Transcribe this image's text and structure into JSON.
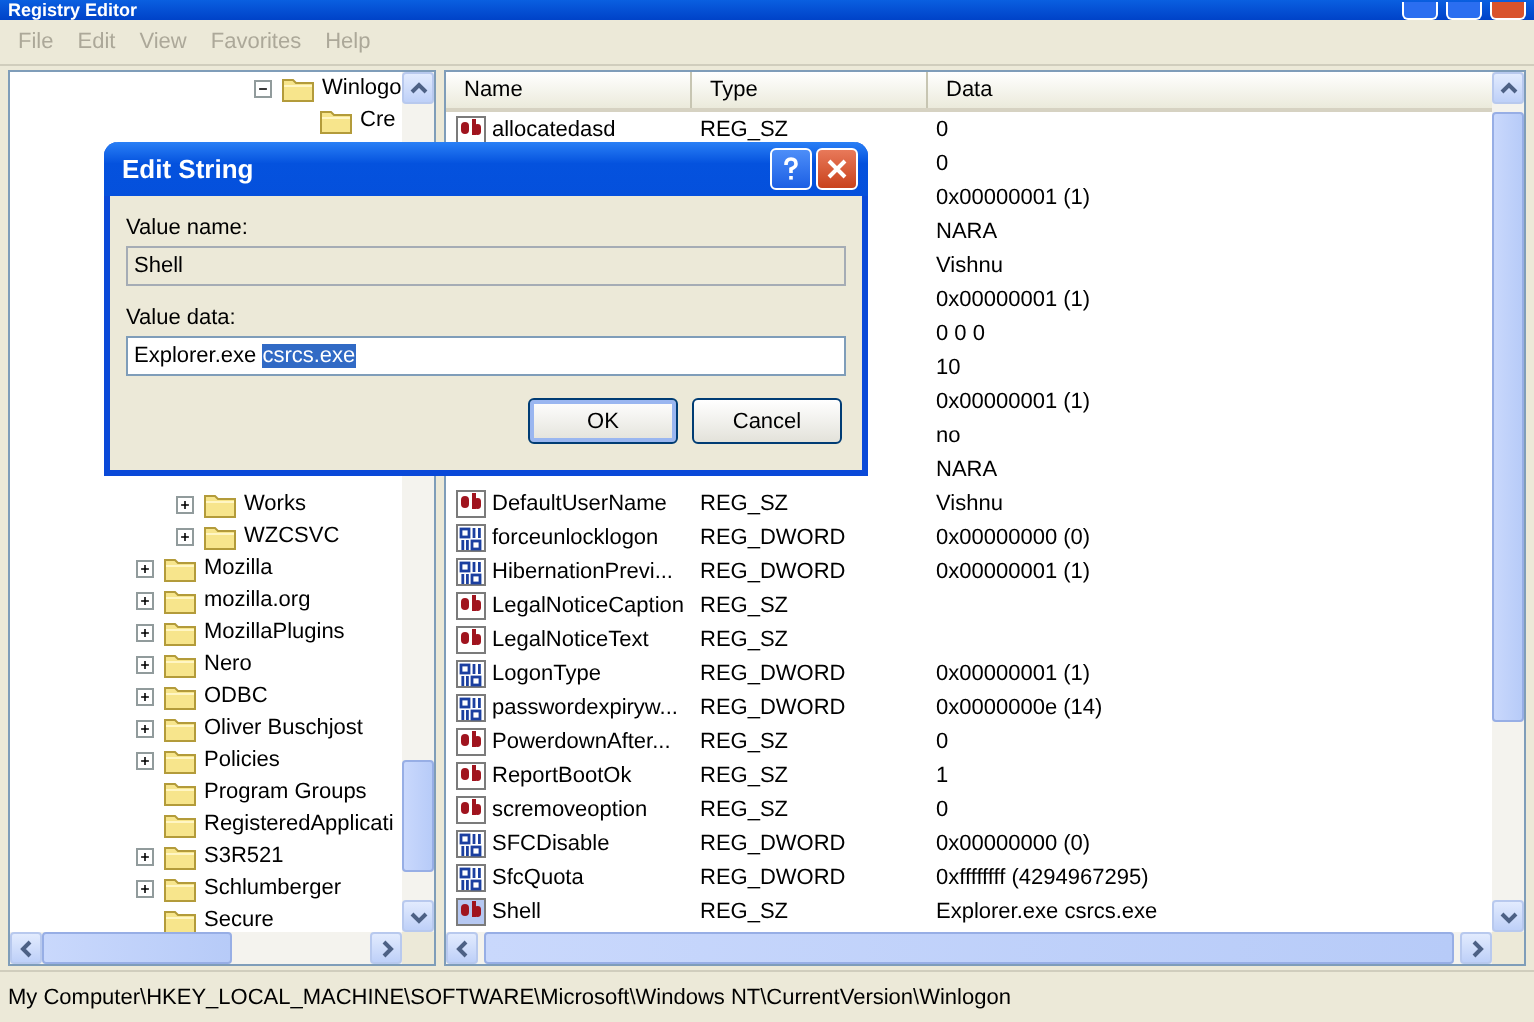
{
  "window": {
    "title": "Registry Editor"
  },
  "menu": [
    {
      "label": "File",
      "disabled": true
    },
    {
      "label": "Edit",
      "disabled": true
    },
    {
      "label": "View",
      "disabled": true
    },
    {
      "label": "Favorites",
      "disabled": true
    },
    {
      "label": "Help",
      "disabled": true
    }
  ],
  "tree": {
    "items": [
      {
        "children": [
          {
            "children": [
              {
                "children": [
                  {
                    "label": "Winlogo",
                    "expanded": true,
                    "children": [
                      {
                        "label": "Cre"
                      }
                    ]
                  }
                ]
              }
            ]
          },
          {
            "label": "Works",
            "expanded": false
          },
          {
            "label": "WZCSVC",
            "expanded": false
          }
        ]
      },
      {
        "label": "Mozilla",
        "expanded": false
      },
      {
        "label": "mozilla.org",
        "expanded": false
      },
      {
        "label": "MozillaPlugins",
        "expanded": false
      },
      {
        "label": "Nero",
        "expanded": false
      },
      {
        "label": "ODBC",
        "expanded": false
      },
      {
        "label": "Oliver Buschjost",
        "expanded": false
      },
      {
        "label": "Policies",
        "expanded": false
      },
      {
        "label": "Program Groups"
      },
      {
        "label": "RegisteredApplicati"
      },
      {
        "label": "S3R521",
        "expanded": false
      },
      {
        "label": "Schlumberger",
        "expanded": false
      },
      {
        "label": "Secure"
      }
    ]
  },
  "list": {
    "columns": [
      "Name",
      "Type",
      "Data"
    ],
    "rows": [
      {
        "kind": "string",
        "name": "allocatedasd",
        "type": "REG_SZ",
        "data": "0",
        "selected": false
      },
      {
        "kind": "covered",
        "data": "0"
      },
      {
        "kind": "covered",
        "data": "0x00000001 (1)"
      },
      {
        "kind": "covered",
        "data": "NARA"
      },
      {
        "kind": "covered",
        "data": "Vishnu"
      },
      {
        "kind": "covered",
        "data": "0x00000001 (1)"
      },
      {
        "kind": "covered",
        "data": "0 0 0"
      },
      {
        "kind": "covered",
        "data": "10"
      },
      {
        "kind": "covered",
        "data": "0x00000001 (1)"
      },
      {
        "kind": "covered",
        "data": "no"
      },
      {
        "kind": "covered",
        "data": "NARA"
      },
      {
        "kind": "string",
        "name": "DefaultUserName",
        "type": "REG_SZ",
        "data": "Vishnu",
        "selected": false
      },
      {
        "kind": "binary",
        "name": "forceunlocklogon",
        "type": "REG_DWORD",
        "data": "0x00000000 (0)",
        "selected": false
      },
      {
        "kind": "binary",
        "name": "HibernationPrevi...",
        "type": "REG_DWORD",
        "data": "0x00000001 (1)",
        "selected": false
      },
      {
        "kind": "string",
        "name": "LegalNoticeCaption",
        "type": "REG_SZ",
        "selected": false
      },
      {
        "kind": "string",
        "name": "LegalNoticeText",
        "type": "REG_SZ",
        "selected": false
      },
      {
        "kind": "binary",
        "name": "LogonType",
        "type": "REG_DWORD",
        "data": "0x00000001 (1)",
        "selected": false
      },
      {
        "kind": "binary",
        "name": "passwordexpiryw...",
        "type": "REG_DWORD",
        "data": "0x0000000e (14)",
        "selected": false
      },
      {
        "kind": "string",
        "name": "PowerdownAfter...",
        "type": "REG_SZ",
        "data": "0",
        "selected": false
      },
      {
        "kind": "string",
        "name": "ReportBootOk",
        "type": "REG_SZ",
        "data": "1",
        "selected": false
      },
      {
        "kind": "string",
        "name": "scremoveoption",
        "type": "REG_SZ",
        "data": "0",
        "selected": false
      },
      {
        "kind": "binary",
        "name": "SFCDisable",
        "type": "REG_DWORD",
        "data": "0x00000000 (0)",
        "selected": false
      },
      {
        "kind": "binary",
        "name": "SfcQuota",
        "type": "REG_DWORD",
        "data": "0xffffffff (4294967295)",
        "selected": false
      },
      {
        "kind": "string",
        "name": "Shell",
        "type": "REG_SZ",
        "data": "Explorer.exe csrcs.exe",
        "selected": true
      }
    ]
  },
  "dialog": {
    "title": "Edit String",
    "name_label": "Value name:",
    "name_value": "Shell",
    "data_label": "Value data:",
    "data_value": "Explorer.exe ",
    "data_selected": "csrcs.exe",
    "buttons": [
      {
        "label": "OK",
        "default": true
      },
      {
        "label": "Cancel",
        "default": false
      }
    ]
  },
  "status_bar": "My Computer\\HKEY_LOCAL_MACHINE\\SOFTWARE\\Microsoft\\Windows NT\\CurrentVersion\\Winlogon"
}
